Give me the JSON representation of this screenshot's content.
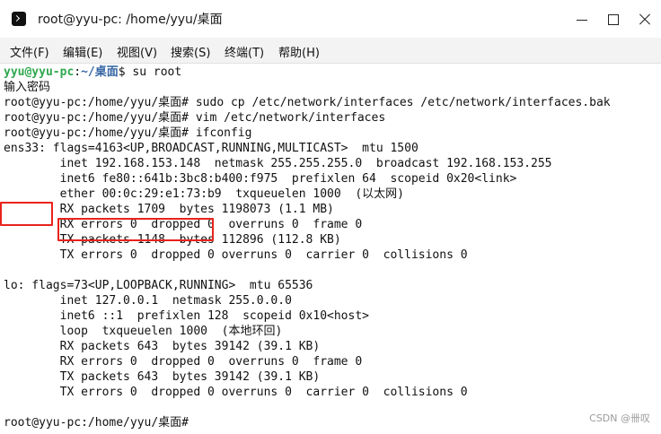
{
  "window": {
    "title": "root@yyu-pc: /home/yyu/桌面"
  },
  "menu": [
    {
      "label": "文件(F)"
    },
    {
      "label": "编辑(E)"
    },
    {
      "label": "视图(V)"
    },
    {
      "label": "搜索(S)"
    },
    {
      "label": "终端(T)"
    },
    {
      "label": "帮助(H)"
    }
  ],
  "terminal": {
    "prompt_user": {
      "user": "yyu@yyu-pc",
      "sep": ":",
      "path": "~/桌面",
      "cmd": "$ su root"
    },
    "lines": [
      "输入密码",
      "root@yyu-pc:/home/yyu/桌面# sudo cp /etc/network/interfaces /etc/network/interfaces.bak",
      "root@yyu-pc:/home/yyu/桌面# vim /etc/network/interfaces",
      "root@yyu-pc:/home/yyu/桌面# ifconfig",
      "ens33: flags=4163<UP,BROADCAST,RUNNING,MULTICAST>  mtu 1500",
      "        inet 192.168.153.148  netmask 255.255.255.0  broadcast 192.168.153.255",
      "        inet6 fe80::641b:3bc8:b400:f975  prefixlen 64  scopeid 0x20<link>",
      "        ether 00:0c:29:e1:73:b9  txqueuelen 1000  (以太网)",
      "        RX packets 1709  bytes 1198073 (1.1 MB)",
      "        RX errors 0  dropped 0  overruns 0  frame 0",
      "        TX packets 1148  bytes 112896 (112.8 KB)",
      "        TX errors 0  dropped 0 overruns 0  carrier 0  collisions 0",
      "",
      "lo: flags=73<UP,LOOPBACK,RUNNING>  mtu 65536",
      "        inet 127.0.0.1  netmask 255.0.0.0",
      "        inet6 ::1  prefixlen 128  scopeid 0x10<host>",
      "        loop  txqueuelen 1000  (本地环回)",
      "        RX packets 643  bytes 39142 (39.1 KB)",
      "        RX errors 0  dropped 0  overruns 0  frame 0",
      "        TX packets 643  bytes 39142 (39.1 KB)",
      "        TX errors 0  dropped 0 overruns 0  carrier 0  collisions 0",
      "",
      "root@yyu-pc:/home/yyu/桌面# "
    ]
  },
  "watermark": "CSDN @卌叹",
  "colors": {
    "prompt_user": "#2fa84f",
    "prompt_path": "#3465a4",
    "highlight": "#e8231c"
  }
}
